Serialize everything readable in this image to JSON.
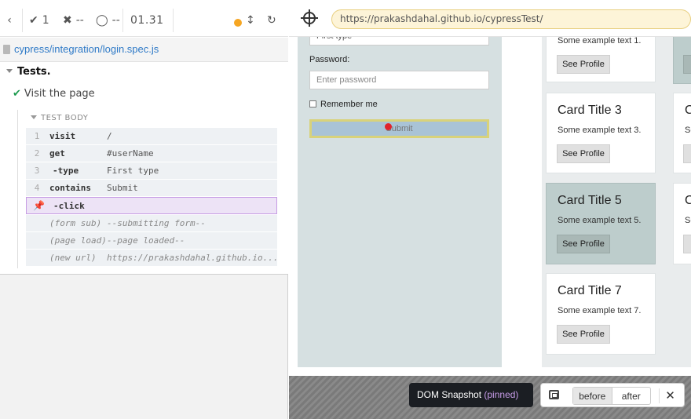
{
  "stats": {
    "back_icon": "chevron-left-icon",
    "passed": "1",
    "failed": "--",
    "pending": "--",
    "duration": "01.31"
  },
  "spec": {
    "path": "cypress/integration/login.spec.js"
  },
  "suite": {
    "title": "Tests."
  },
  "test": {
    "title": "Visit the page"
  },
  "test_body": {
    "header": "TEST BODY",
    "commands": [
      {
        "num": "1",
        "name": "visit",
        "message": "/"
      },
      {
        "num": "2",
        "name": "get",
        "message": "#userName"
      },
      {
        "num": "3",
        "name": "-type",
        "message": "First type"
      },
      {
        "num": "4",
        "name": "contains",
        "message": "Submit"
      },
      {
        "num": "",
        "name": "-click",
        "message": ""
      },
      {
        "num": "",
        "name": "(form sub)",
        "message": "--submitting form--"
      },
      {
        "num": "",
        "name": "(page load)",
        "message": "--page loaded--"
      },
      {
        "num": "",
        "name": "(new url)",
        "message": "https://prakashdahal.github.io..."
      }
    ]
  },
  "browser": {
    "url": "https://prakashdahal.github.io/cypressTest/"
  },
  "app": {
    "first_field_value": "First type",
    "password_label": "Password:",
    "password_placeholder": "Enter password",
    "remember_label": "Remember me",
    "submit_label": "Submit",
    "cards": [
      {
        "title": "",
        "text": "Some example text 1.",
        "button": "See Profile"
      },
      {
        "title": "Card Title 3",
        "text": "Some example text 3.",
        "button": "See Profile"
      },
      {
        "title": "Card Title 5",
        "text": "Some example text 5.",
        "button": "See Profile"
      },
      {
        "title": "Card Title 7",
        "text": "Some example text 7.",
        "button": "See Profile"
      }
    ],
    "cards_right": [
      {
        "title": "C",
        "text": "Sc"
      },
      {
        "title": "C",
        "text": "Sc"
      }
    ]
  },
  "snapshot": {
    "label": "DOM Snapshot",
    "pinned": "(pinned)",
    "before": "before",
    "after": "after",
    "close": "✕"
  },
  "colors": {
    "pass": "#1c9a4e",
    "fail": "#d9383a",
    "pinned_purple": "#8e3ec7",
    "running_dot": "#f6a623"
  }
}
